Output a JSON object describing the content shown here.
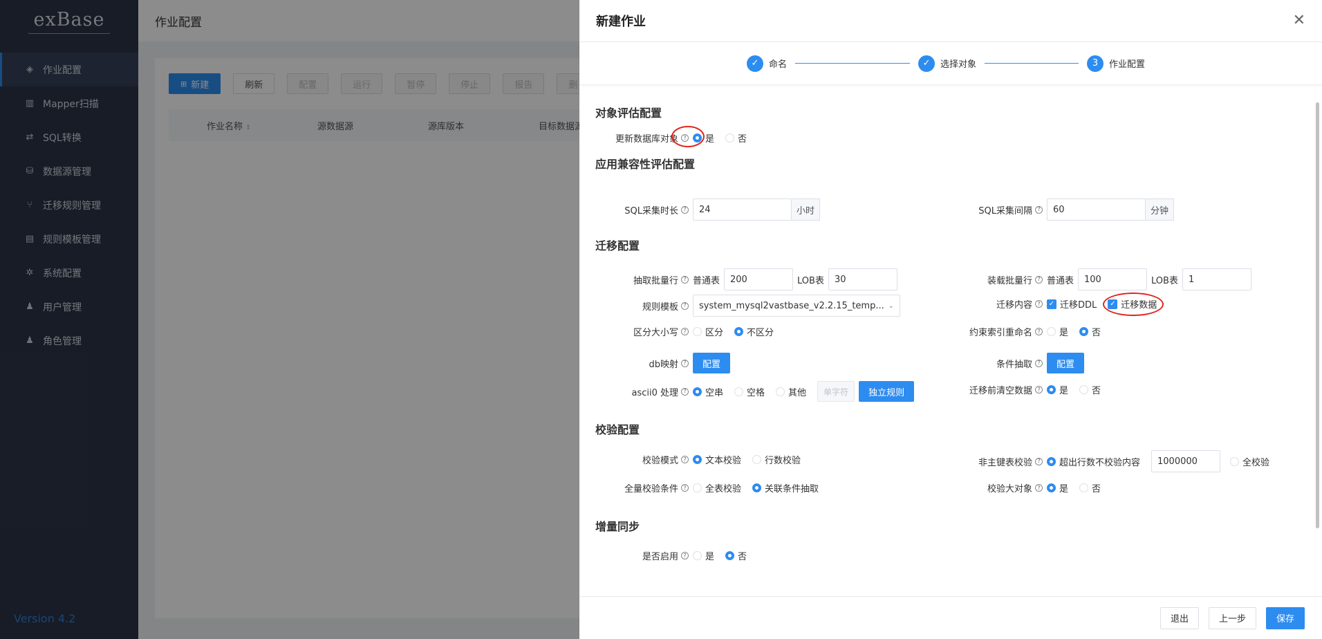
{
  "app": {
    "logo": "exBase",
    "version": "Version 4.2"
  },
  "sidebar": {
    "items": [
      {
        "label": "作业配置",
        "icon": "layers-icon"
      },
      {
        "label": "Mapper扫描",
        "icon": "barcode-icon"
      },
      {
        "label": "SQL转换",
        "icon": "swap-icon"
      },
      {
        "label": "数据源管理",
        "icon": "database-icon"
      },
      {
        "label": "迁移规则管理",
        "icon": "branch-icon"
      },
      {
        "label": "规则模板管理",
        "icon": "template-icon"
      },
      {
        "label": "系统配置",
        "icon": "gear-icon"
      },
      {
        "label": "用户管理",
        "icon": "user-icon"
      },
      {
        "label": "角色管理",
        "icon": "users-icon"
      }
    ]
  },
  "main": {
    "title": "作业配置",
    "toolbar": {
      "new": "新建",
      "refresh": "刷新",
      "config": "配置",
      "run": "运行",
      "pause": "暂停",
      "stop": "停止",
      "report": "报告",
      "more": "删"
    },
    "table_headers": [
      "作业名称",
      "源数据源",
      "源库版本",
      "目标数据源"
    ]
  },
  "drawer": {
    "title": "新建作业",
    "steps": [
      {
        "label": "命名"
      },
      {
        "label": "选择对象"
      },
      {
        "num": "3",
        "label": "作业配置"
      }
    ],
    "sections": {
      "object_eval": "对象评估配置",
      "app_compat": "应用兼容性评估配置",
      "migration": "迁移配置",
      "verify": "校验配置",
      "incremental": "增量同步"
    },
    "update_db_object": {
      "label": "更新数据库对象",
      "opt_yes": "是",
      "opt_no": "否"
    },
    "sql_collect_duration": {
      "label": "SQL采集时长",
      "value": "24",
      "unit": "小时"
    },
    "sql_collect_interval": {
      "label": "SQL采集间隔",
      "value": "60",
      "unit": "分钟"
    },
    "extract_batch": {
      "label": "抽取批量行",
      "normal_label": "普通表",
      "normal_value": "200",
      "lob_label": "LOB表",
      "lob_value": "30"
    },
    "load_batch": {
      "label": "装载批量行",
      "normal_label": "普通表",
      "normal_value": "100",
      "lob_label": "LOB表",
      "lob_value": "1"
    },
    "rule_template": {
      "label": "规则模板",
      "value": "system_mysql2vastbase_v2.2.15_temp..."
    },
    "migrate_content": {
      "label": "迁移内容",
      "opt_ddl": "迁移DDL",
      "opt_data": "迁移数据"
    },
    "case_sensitive": {
      "label": "区分大小写",
      "opt_yes": "区分",
      "opt_no": "不区分"
    },
    "constraint_rename": {
      "label": "约束索引重命名",
      "opt_yes": "是",
      "opt_no": "否"
    },
    "db_mapping": {
      "label": "db映射",
      "button": "配置"
    },
    "condition_extract": {
      "label": "条件抽取",
      "button": "配置"
    },
    "ascii0": {
      "label": "ascii0 处理",
      "opt_empty": "空串",
      "opt_space": "空格",
      "opt_other": "其他",
      "char_placeholder": "单字符",
      "rule_button": "独立规则"
    },
    "clear_before": {
      "label": "迁移前清空数据",
      "opt_yes": "是",
      "opt_no": "否"
    },
    "verify_mode": {
      "label": "校验模式",
      "opt_text": "文本校验",
      "opt_rows": "行数校验"
    },
    "non_pk_verify": {
      "label": "非主键表校验",
      "opt_exceed": "超出行数不校验内容",
      "value": "1000000",
      "opt_full": "全校验"
    },
    "full_verify_cond": {
      "label": "全量校验条件",
      "opt_full": "全表校验",
      "opt_related": "关联条件抽取"
    },
    "verify_large": {
      "label": "校验大对象",
      "opt_yes": "是",
      "opt_no": "否"
    },
    "enable": {
      "label": "是否启用",
      "opt_yes": "是",
      "opt_no": "否"
    },
    "footer": {
      "exit": "退出",
      "prev": "上一步",
      "save": "保存"
    }
  },
  "colors": {
    "primary": "#2d8cf0",
    "sidebar": "#2b3447",
    "annotation": "#e0261b"
  }
}
